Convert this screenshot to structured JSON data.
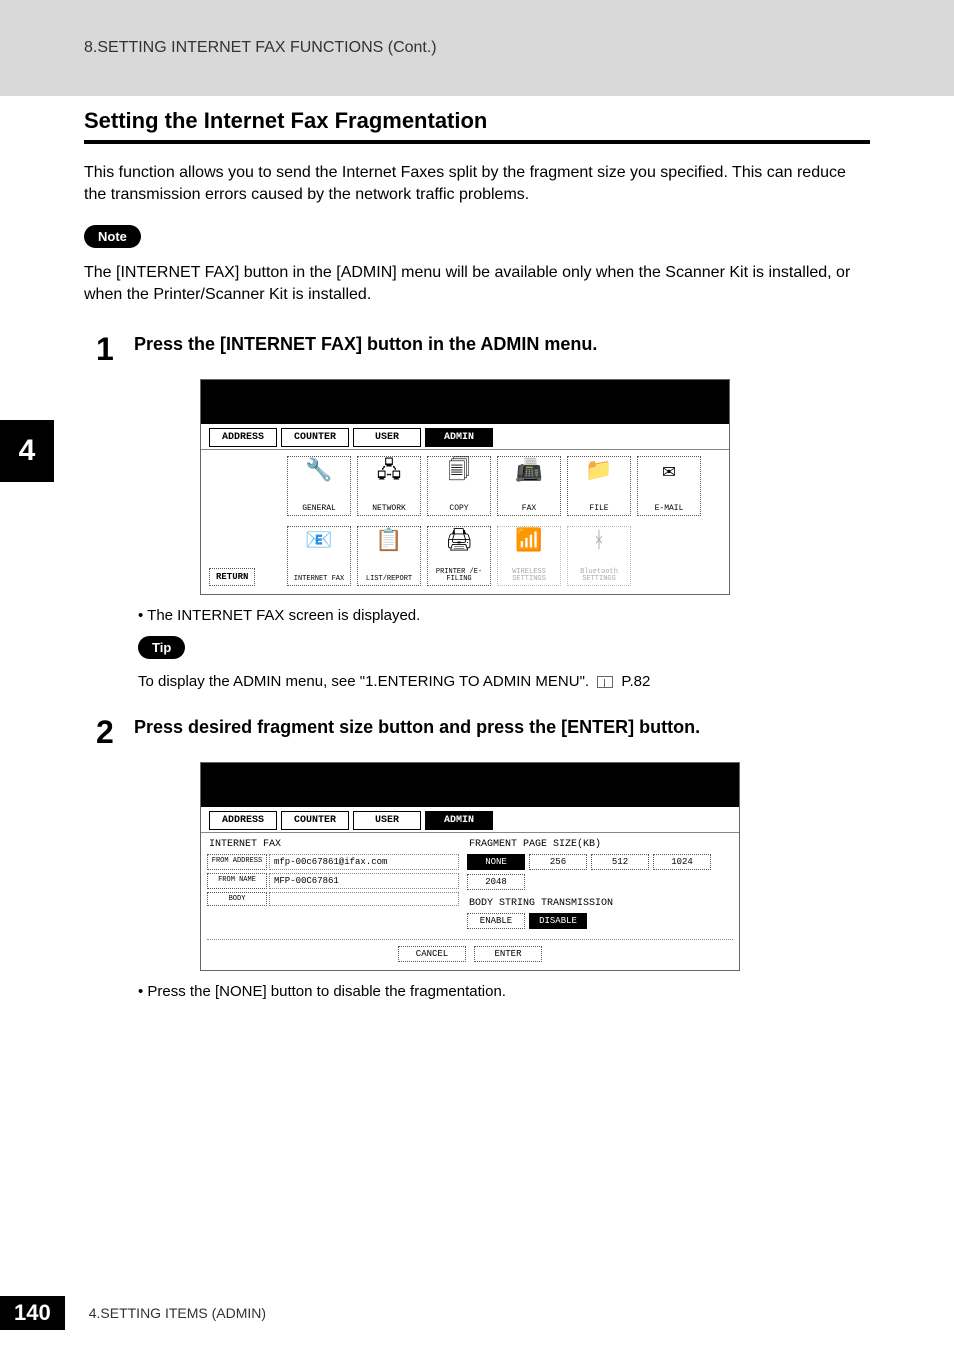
{
  "header": {
    "breadcrumb": "8.SETTING INTERNET FAX FUNCTIONS (Cont.)"
  },
  "section": {
    "title": "Setting the Internet Fax Fragmentation",
    "intro": "This function allows you to send the Internet Faxes split by the fragment size you specified.  This can reduce the transmission errors caused by the network traffic problems."
  },
  "note": {
    "label": "Note",
    "text": "The [INTERNET FAX] button in the [ADMIN] menu will be available only when the Scanner Kit is installed, or when the Printer/Scanner Kit is installed."
  },
  "side_tab": "4",
  "steps": [
    {
      "num": "1",
      "text": "Press the [INTERNET FAX] button in the ADMIN menu."
    },
    {
      "num": "2",
      "text": "Press desired fragment size button and press the [ENTER] button."
    }
  ],
  "step1": {
    "bullet": "The INTERNET FAX screen is displayed.",
    "tip_label": "Tip",
    "tip_text_prefix": "To display the ADMIN menu, see \"1.ENTERING TO ADMIN MENU\".",
    "tip_page": "P.82"
  },
  "step2": {
    "bullet": "Press the [NONE] button to disable the fragmentation."
  },
  "screen1": {
    "tabs": [
      "ADDRESS",
      "COUNTER",
      "USER",
      "ADMIN"
    ],
    "active_tab": "ADMIN",
    "row1": [
      {
        "label": "GENERAL"
      },
      {
        "label": "NETWORK"
      },
      {
        "label": "COPY"
      },
      {
        "label": "FAX"
      },
      {
        "label": "FILE"
      },
      {
        "label": "E-MAIL"
      }
    ],
    "row2": [
      {
        "label": "INTERNET FAX"
      },
      {
        "label": "LIST/REPORT"
      },
      {
        "label": "PRINTER /E-FILING"
      },
      {
        "label": "WIRELESS SETTINGS",
        "dim": true
      },
      {
        "label": "Bluetooth SETTINGS",
        "dim": true
      }
    ],
    "return": "RETURN"
  },
  "screen2": {
    "tabs": [
      "ADDRESS",
      "COUNTER",
      "USER",
      "ADMIN"
    ],
    "active_tab": "ADMIN",
    "left_title": "INTERNET FAX",
    "from_address_label": "FROM ADDRESS",
    "from_address_value": "mfp-00c67861@ifax.com",
    "from_name_label": "FROM NAME",
    "from_name_value": "MFP-00C67861",
    "body_label": "BODY",
    "body_value": "",
    "right_title": "FRAGMENT PAGE SIZE(KB)",
    "sizes": [
      "NONE",
      "256",
      "512",
      "1024",
      "2048"
    ],
    "active_size": "NONE",
    "bst_title": "BODY STRING TRANSMISSION",
    "bst_enable": "ENABLE",
    "bst_disable": "DISABLE",
    "cancel": "CANCEL",
    "enter": "ENTER"
  },
  "footer": {
    "page_num": "140",
    "text": "4.SETTING ITEMS (ADMIN)"
  }
}
